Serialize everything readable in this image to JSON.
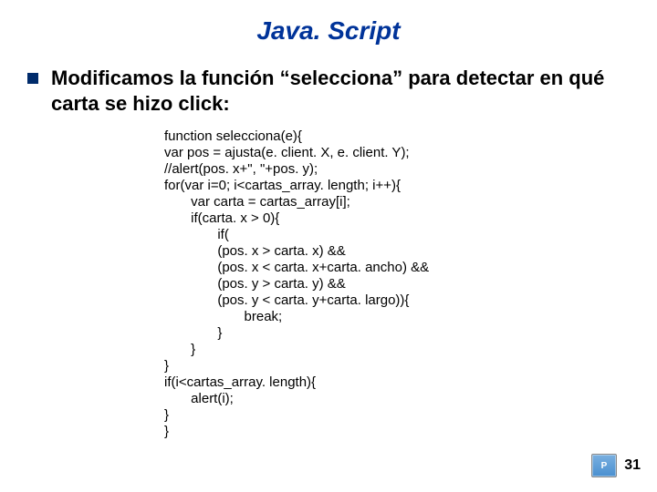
{
  "title": "Java. Script",
  "bullet": "Modificamos la función “selecciona” para detectar en qué carta se hizo click:",
  "code": "function selecciona(e){\nvar pos = ajusta(e. client. X, e. client. Y);\n//alert(pos. x+\", \"+pos. y);\nfor(var i=0; i<cartas_array. length; i++){\n       var carta = cartas_array[i];\n       if(carta. x > 0){\n              if(\n              (pos. x > carta. x) &&\n              (pos. x < carta. x+carta. ancho) &&\n              (pos. y > carta. y) &&\n              (pos. y < carta. y+carta. largo)){\n                     break;\n              }\n       }\n}\nif(i<cartas_array. length){\n       alert(i);\n}\n}",
  "page_number": "31",
  "logo_text": "P"
}
